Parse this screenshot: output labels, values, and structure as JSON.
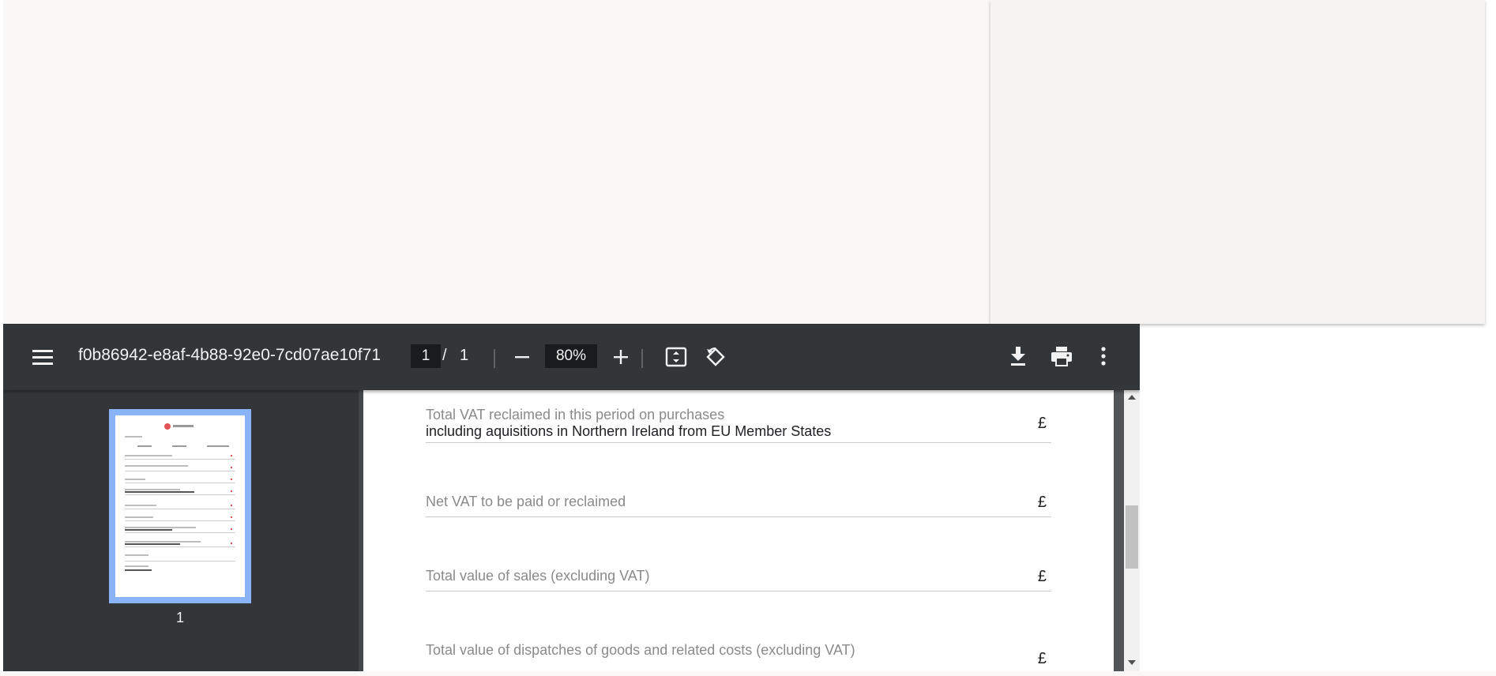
{
  "viewer": {
    "menu_icon": "hamburger-menu-icon",
    "title": "f0b86942-e8af-4b88-92e0-7cd07ae10f71",
    "page_current": "1",
    "page_separator": "/",
    "page_total": "1",
    "zoom": "80%",
    "toolbar_icons": [
      "zoom-out-icon",
      "zoom-in-icon",
      "fit-page-icon",
      "rotate-icon",
      "download-icon",
      "print-icon",
      "more-options-icon"
    ]
  },
  "sidebar": {
    "thumbnail_page": "1"
  },
  "document": {
    "fields": [
      {
        "label": "Total VAT reclaimed in this period on purchases",
        "sublabel": "including aquisitions in Northern Ireland from EU Member States",
        "currency": "£"
      },
      {
        "label": "Net VAT to be paid or reclaimed",
        "currency": "£"
      },
      {
        "label": "Total value of sales (excluding VAT)",
        "currency": "£"
      },
      {
        "label": "Total value of dispatches of goods and related costs (excluding VAT)",
        "currency": "£"
      }
    ]
  },
  "colors": {
    "toolbar": "#323639",
    "viewer_background": "#525659",
    "thumbnail_highlight": "#8ab4f8",
    "top_area": "#f9f8f6"
  }
}
